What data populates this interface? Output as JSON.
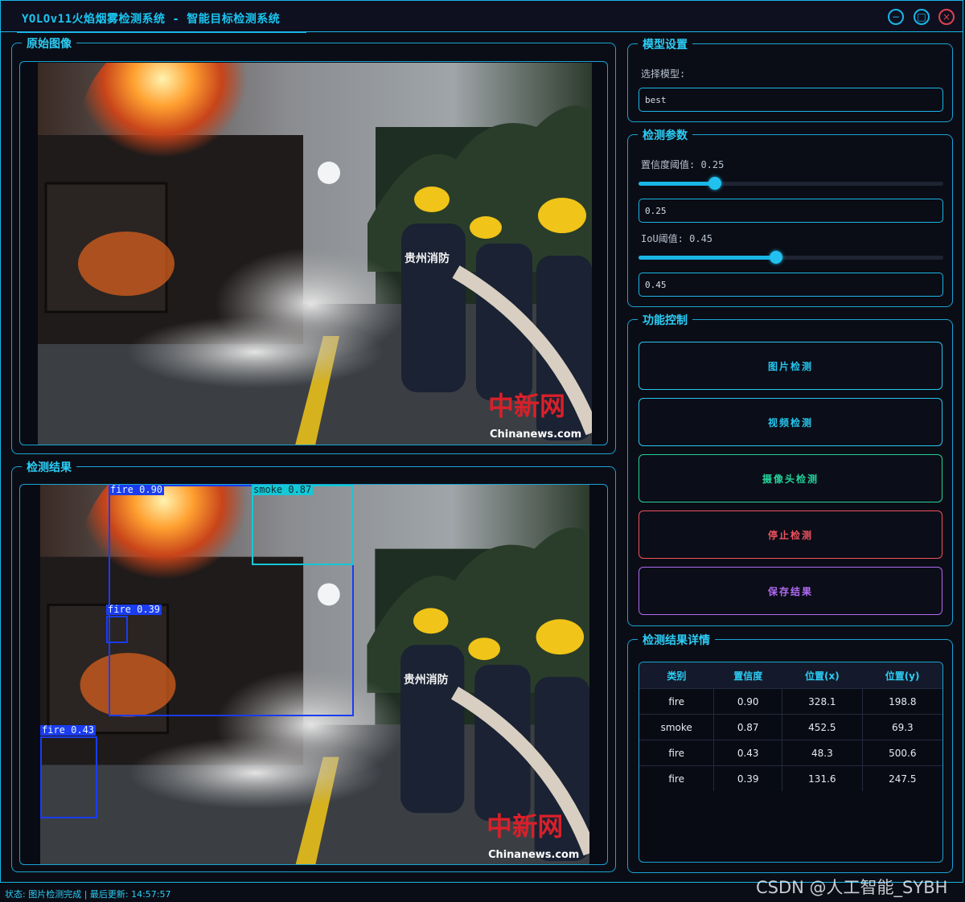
{
  "window": {
    "title": "YOLOv11火焰烟雾检测系统 - 智能目标检测系统",
    "controls": {
      "minimize": "−",
      "maximize": "□",
      "close": "×"
    }
  },
  "panels": {
    "original_title": "原始图像",
    "result_title": "检测结果",
    "model_title": "模型设置",
    "params_title": "检测参数",
    "control_title": "功能控制",
    "details_title": "检测结果详情"
  },
  "model": {
    "select_label": "选择模型:",
    "selected": "best"
  },
  "params": {
    "conf_label": "置信度阈值: 0.25",
    "conf_value": "0.25",
    "conf_level": 0.25,
    "iou_label": "IoU阈值: 0.45",
    "iou_value": "0.45",
    "iou_level": 0.45
  },
  "controls": {
    "image_detect": "图片检测",
    "video_detect": "视频检测",
    "camera_detect": "摄像头检测",
    "stop_detect": "停止检测",
    "save_result": "保存结果"
  },
  "photo": {
    "watermark_brand": "中新网",
    "watermark_url": "Chinanews.com",
    "jacket_text": "贵州消防"
  },
  "detections_overlay": [
    {
      "label": "fire 0.90",
      "color": "#1b3cf0"
    },
    {
      "label": "smoke 0.87",
      "color": "#14c8d6"
    },
    {
      "label": "fire 0.39",
      "color": "#1b3cf0"
    },
    {
      "label": "fire 0.43",
      "color": "#1b3cf0"
    }
  ],
  "table": {
    "headers": [
      "类别",
      "置信度",
      "位置(x)",
      "位置(y)"
    ],
    "rows": [
      [
        "fire",
        "0.90",
        "328.1",
        "198.8"
      ],
      [
        "smoke",
        "0.87",
        "452.5",
        "69.3"
      ],
      [
        "fire",
        "0.43",
        "48.3",
        "500.6"
      ],
      [
        "fire",
        "0.39",
        "131.6",
        "247.5"
      ]
    ]
  },
  "status": "状态: 图片检测完成 | 最后更新: 14:57:57",
  "watermark": "CSDN @人工智能_SYBH",
  "colors": {
    "accent": "#19b6e6",
    "title": "#2ccdf5",
    "image_btn": "#26c6ee",
    "camera_btn": "#22d39a",
    "stop_btn": "#f0525e",
    "save_btn": "#b06af0"
  }
}
